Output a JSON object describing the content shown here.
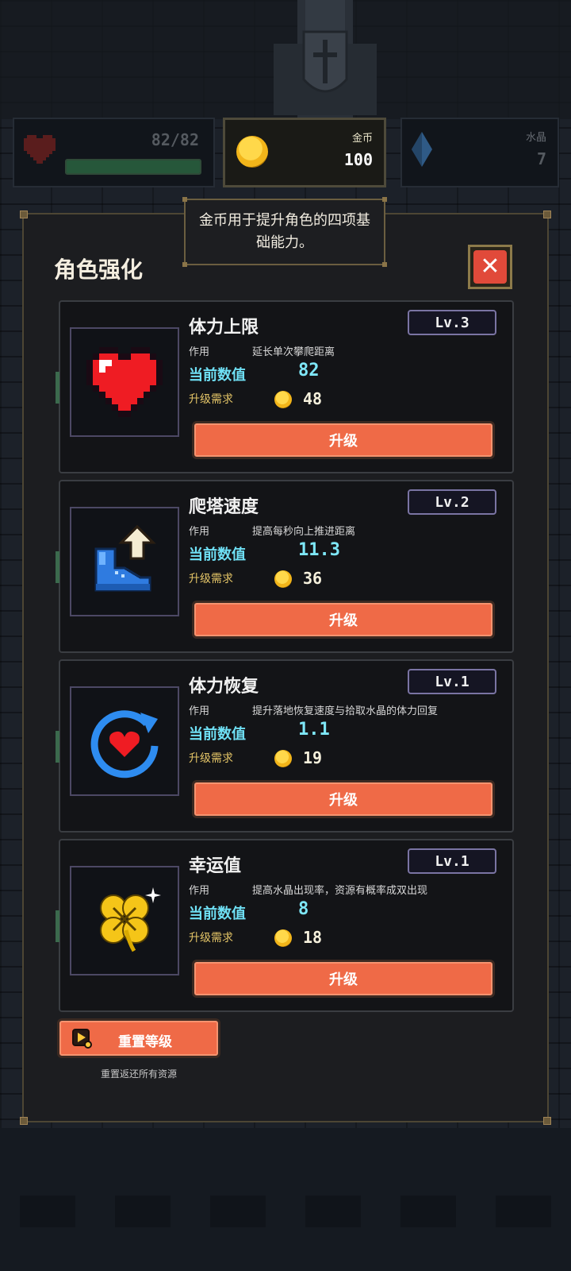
{
  "hud": {
    "hp_text": "82/82",
    "hp_fraction": 1.0,
    "coin_label": "金币",
    "coin_value": "100",
    "gem_label": "水晶",
    "gem_value": "7"
  },
  "tooltip": {
    "text": "金币用于提升角色的四项基础能力。"
  },
  "modal": {
    "title": "角色强化"
  },
  "labels": {
    "effect": "作用",
    "current": "当前数值",
    "requirement": "升级需求",
    "upgrade": "升级"
  },
  "upgrades": [
    {
      "name": "体力上限",
      "level": "Lv.3",
      "effect": "延长单次攀爬距离",
      "current": "82",
      "cost": "48",
      "icon": "heart-icon"
    },
    {
      "name": "爬塔速度",
      "level": "Lv.2",
      "effect": "提高每秒向上推进距离",
      "current": "11.3",
      "cost": "36",
      "icon": "boot-arrow-icon"
    },
    {
      "name": "体力恢复",
      "level": "Lv.1",
      "effect": "提升落地恢复速度与拾取水晶的体力回复",
      "current": "1.1",
      "cost": "19",
      "icon": "heart-refresh-icon"
    },
    {
      "name": "幸运值",
      "level": "Lv.1",
      "effect": "提高水晶出现率，资源有概率成双出现",
      "current": "8",
      "cost": "18",
      "icon": "clover-icon"
    }
  ],
  "reset": {
    "label": "重置等级",
    "note": "重置返还所有资源",
    "icon": "video-ad-icon"
  },
  "colors": {
    "accent_button": "#ef6a47",
    "current_value": "#7ee7f8",
    "requirement_label": "#e3c467",
    "modal_bg": "#1c1d20"
  }
}
